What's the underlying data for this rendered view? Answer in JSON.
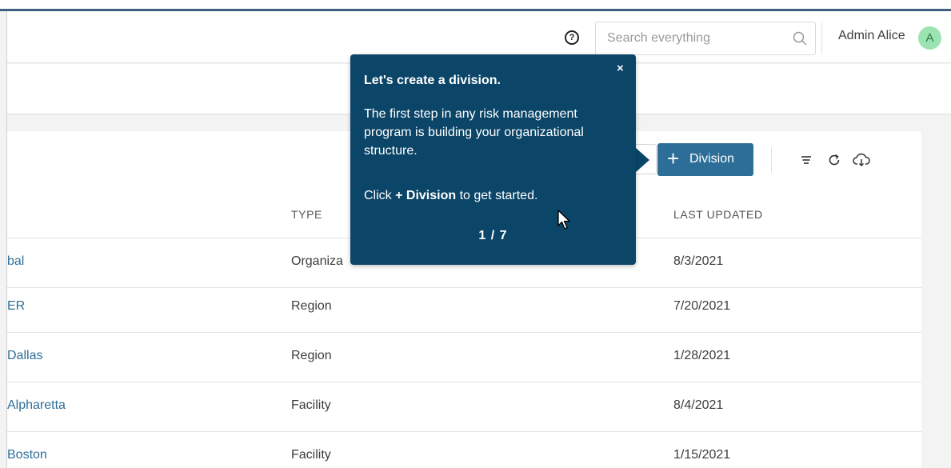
{
  "header": {
    "search": {
      "placeholder": "Search everything",
      "value": ""
    },
    "user": {
      "name": "Admin Alice",
      "initial": "A"
    },
    "help_glyph": "?"
  },
  "toolbar": {
    "add_division": {
      "plus": "+",
      "label": "Division"
    },
    "icons": [
      "list-lines-icon",
      "refresh-icon",
      "cloud-download-icon"
    ]
  },
  "table": {
    "columns": {
      "type": "TYPE",
      "last_updated": "LAST UPDATED"
    },
    "rows": [
      {
        "name": "bal",
        "type": "Organiza",
        "last_updated": "8/3/2021"
      },
      {
        "name": "ER",
        "type": "Region",
        "last_updated": "7/20/2021"
      },
      {
        "name": "Dallas",
        "type": "Region",
        "last_updated": "1/28/2021"
      },
      {
        "name": "Alpharetta",
        "type": "Facility",
        "last_updated": "8/4/2021"
      },
      {
        "name": "Boston",
        "type": "Facility",
        "last_updated": "1/15/2021"
      }
    ]
  },
  "tour": {
    "close": "×",
    "title": "Let's create a division.",
    "body": "The first step in any risk management program is building your organizational structure.",
    "cta_prefix": "Click ",
    "cta_bold": "+ Division",
    "cta_suffix": " to get started.",
    "step": "1 / 7"
  },
  "colors": {
    "top_stripe": "#3e5f7d",
    "primary": "#2d6e98",
    "tour_bg": "#0b4568",
    "avatar_bg": "#9be3b0"
  }
}
